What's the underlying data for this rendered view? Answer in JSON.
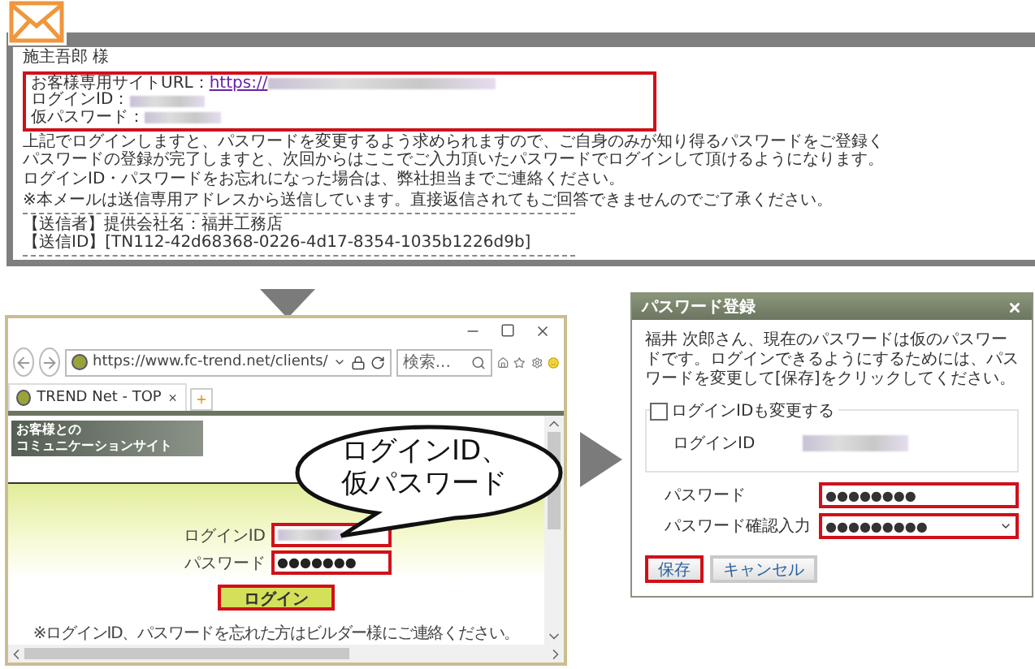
{
  "email": {
    "salutation": "施主吾郎 様",
    "credentials": {
      "highlighted": true,
      "items": [
        {
          "label": "お客様専用サイトURL：",
          "kind": "link",
          "value": "https://"
        },
        {
          "label": "ログインID：",
          "kind": "hidden"
        },
        {
          "label": "仮パスワード：",
          "kind": "hidden"
        }
      ]
    },
    "paragraphs": [
      [
        "上記でログインしますと、パスワードを変更するよう求められますので、ご自身のみが知り得るパスワードをご登録く",
        "パスワードの登録が完了しますと、次回からはここでご入力頂いたパスワードでログインして頂けるようになります。"
      ],
      [
        "ログインID・パスワードをお忘れになった場合は、弊社担当までご連絡ください。"
      ],
      [
        "※本メールは送信専用アドレスから送信しています。直接返信されてもご回答できませんのでご了承ください。"
      ]
    ],
    "sender_lines": [
      "【送信者】提供会社名：福井工務店",
      "【送信ID】[TN112-42d68368-0226-4d17-8354-1035b1226d9b]"
    ]
  },
  "browser": {
    "url": "https://www.fc-trend.net/clients/",
    "search_placeholder": "検索...",
    "tab_title": "TREND Net - TOP",
    "banner_lines": [
      "お客様との",
      "コミュニケーションサイト"
    ],
    "login_fields": [
      {
        "label": "ログインID",
        "kind": "hidden",
        "highlighted": true
      },
      {
        "label": "パスワード",
        "kind": "password",
        "value": "●●●●●●●",
        "highlighted": true
      }
    ],
    "login_button": {
      "label": "ログイン",
      "highlighted": true
    },
    "note": "※ログインID、パスワードを忘れた方はビルダー様にご連絡ください。",
    "callout_lines": [
      "ログインID、",
      "仮パスワード"
    ]
  },
  "dialog": {
    "title": "パスワード登録",
    "message": "福井 次郎さん、現在のパスワードは仮のパスワードです。ログインできるようにするためには、パスワードを変更して[保存]をクリックしてください。",
    "change_id": {
      "label": "ログインIDも変更する",
      "checked": false
    },
    "login_id": {
      "label": "ログインID",
      "kind": "hidden"
    },
    "password_fields": [
      {
        "label": "パスワード",
        "value": "●●●●●●●●",
        "highlighted": true,
        "kind": "input"
      },
      {
        "label": "パスワード確認入力",
        "value": "●●●●●●●●●",
        "highlighted": true,
        "kind": "select"
      }
    ],
    "buttons": [
      {
        "label": "保存",
        "highlighted": true
      },
      {
        "label": "キャンセル",
        "highlighted": false
      }
    ]
  }
}
